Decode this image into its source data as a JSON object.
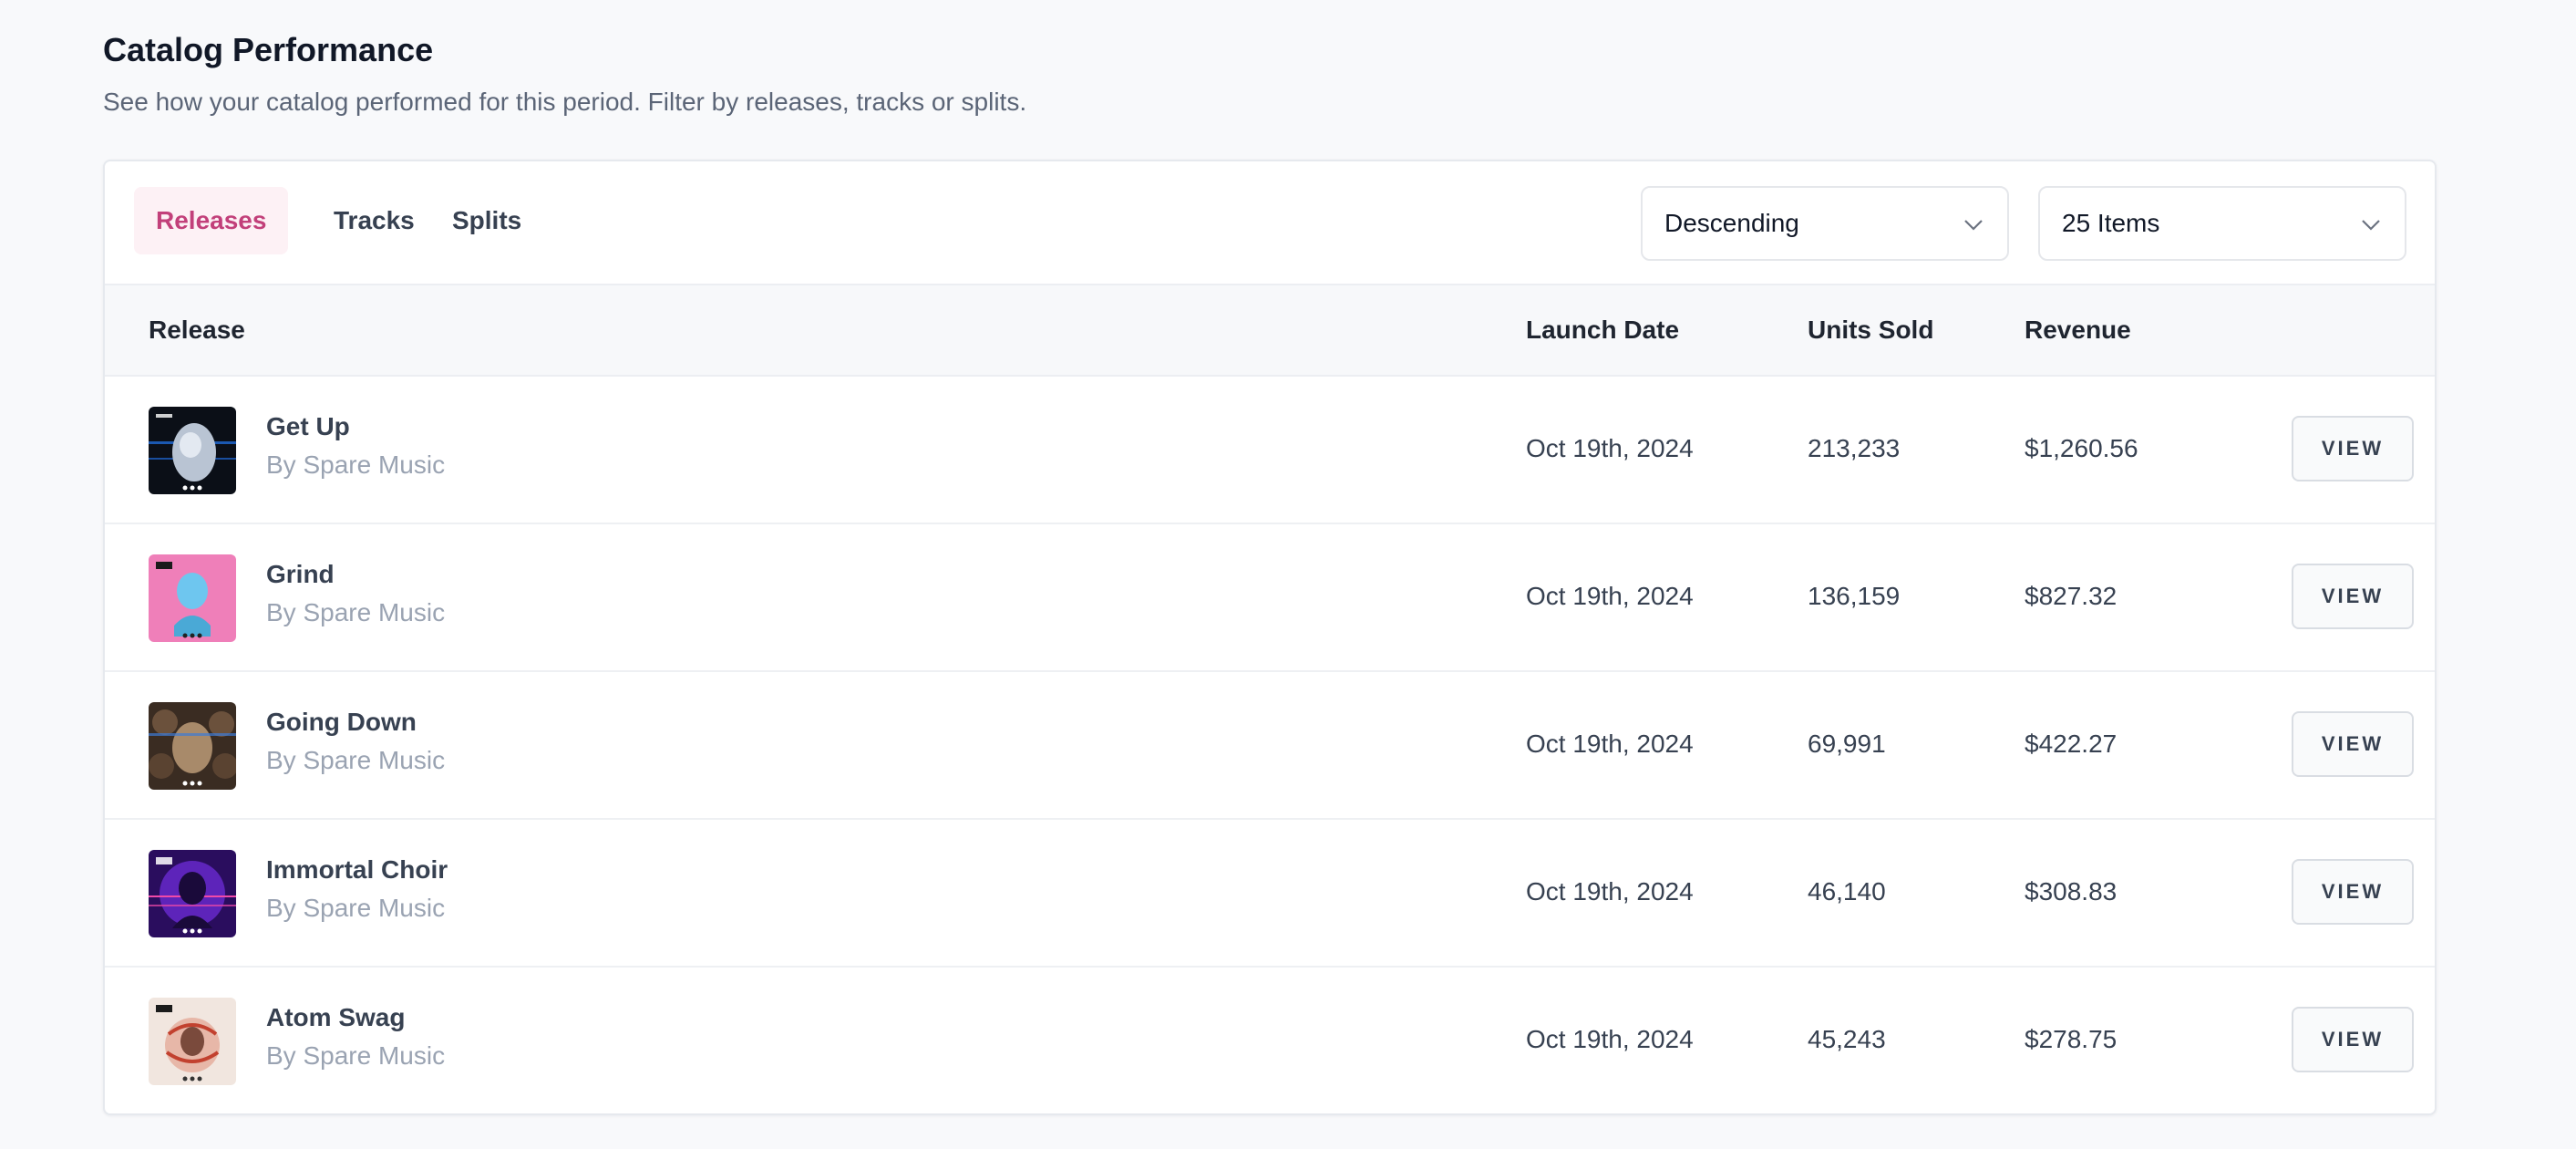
{
  "header": {
    "title": "Catalog Performance",
    "subtitle": "See how your catalog performed for this period. Filter by releases, tracks or splits."
  },
  "tabs": [
    {
      "label": "Releases",
      "active": true
    },
    {
      "label": "Tracks",
      "active": false
    },
    {
      "label": "Splits",
      "active": false
    }
  ],
  "filters": {
    "sort_value": "Descending",
    "page_size_value": "25 Items"
  },
  "table": {
    "columns": [
      "Release",
      "Launch Date",
      "Units Sold",
      "Revenue"
    ],
    "view_label": "VIEW",
    "rows": [
      {
        "title": "Get Up",
        "artist": "By Spare Music",
        "date": "Oct 19th, 2024",
        "units": "213,233",
        "revenue": "$1,260.56"
      },
      {
        "title": "Grind",
        "artist": "By Spare Music",
        "date": "Oct 19th, 2024",
        "units": "136,159",
        "revenue": "$827.32"
      },
      {
        "title": "Going Down",
        "artist": "By Spare Music",
        "date": "Oct 19th, 2024",
        "units": "69,991",
        "revenue": "$422.27"
      },
      {
        "title": "Immortal Choir",
        "artist": "By Spare Music",
        "date": "Oct 19th, 2024",
        "units": "46,140",
        "revenue": "$308.83"
      },
      {
        "title": "Atom Swag",
        "artist": "By Spare Music",
        "date": "Oct 19th, 2024",
        "units": "45,243",
        "revenue": "$278.75"
      }
    ]
  },
  "colors": {
    "accent": "#c2407a",
    "accent_bg": "#fdf1f5"
  }
}
